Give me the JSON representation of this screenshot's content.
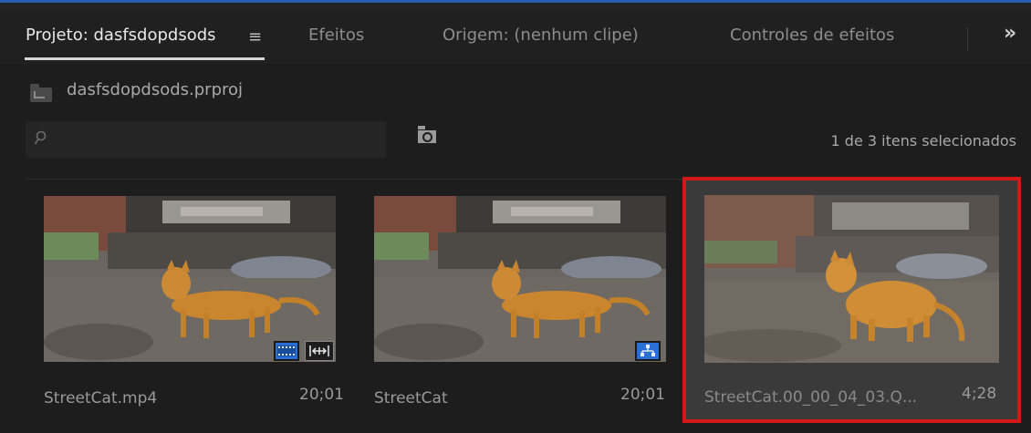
{
  "colors": {
    "accent": "#2a5fb0",
    "selection_outline": "#d21818",
    "badge_blue": "#2a6fd6"
  },
  "tabs": [
    {
      "label": "Projeto: dasfsdopdsods",
      "active": true
    },
    {
      "label": "Efeitos",
      "active": false
    },
    {
      "label": "Origem: (nenhum clipe)",
      "active": false
    },
    {
      "label": "Controles de efeitos",
      "active": false
    }
  ],
  "tab_menu_icon": "hamburger-icon",
  "overflow_label": "»",
  "project": {
    "file_name": "dasfsdopdsods.prproj",
    "icon": "folder-icon"
  },
  "search": {
    "placeholder": "",
    "icon": "search-icon"
  },
  "new_bin_icon": "bin-search-icon",
  "selection_status": "1 de 3 itens selecionados",
  "items": [
    {
      "name": "StreetCat.mp4",
      "duration": "20;01",
      "selected": false,
      "badges": [
        "film-icon",
        "audio-icon"
      ]
    },
    {
      "name": "StreetCat",
      "duration": "20;01",
      "selected": false,
      "badges": [
        "sequence-icon"
      ]
    },
    {
      "name": "StreetCat.00_00_04_03.Q...",
      "duration": "4;28",
      "selected": true,
      "badges": []
    }
  ]
}
